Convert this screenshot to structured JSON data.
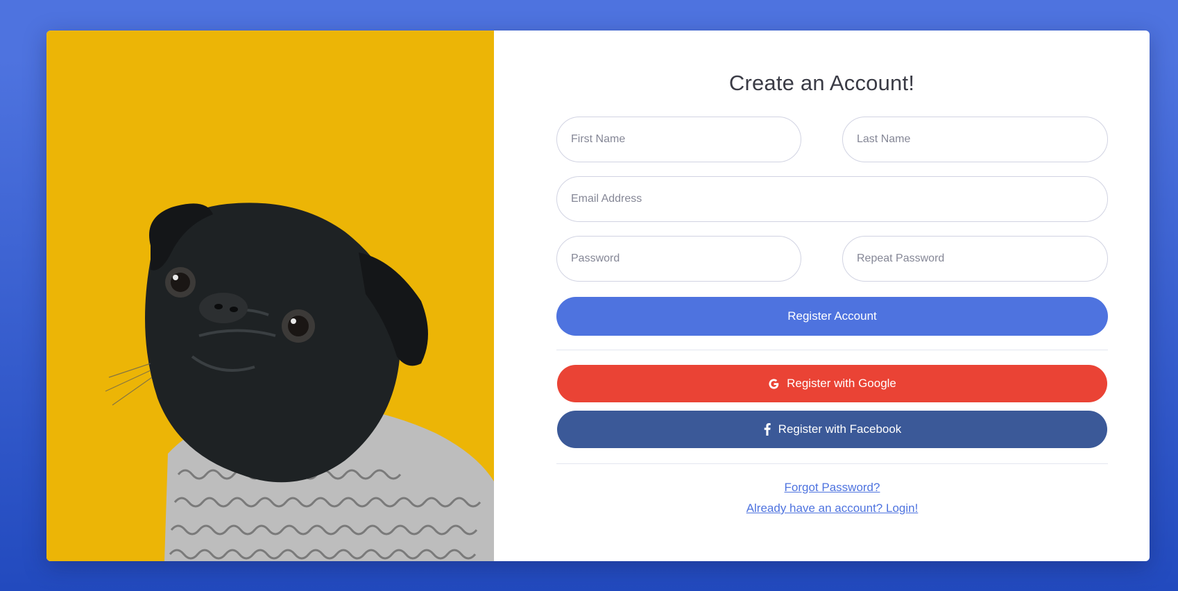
{
  "form": {
    "title": "Create an Account!",
    "first_name": {
      "placeholder": "First Name",
      "value": ""
    },
    "last_name": {
      "placeholder": "Last Name",
      "value": ""
    },
    "email": {
      "placeholder": "Email Address",
      "value": ""
    },
    "password": {
      "placeholder": "Password",
      "value": ""
    },
    "repeat_password": {
      "placeholder": "Repeat Password",
      "value": ""
    },
    "register_label": "Register Account",
    "google_label": "Register with Google",
    "facebook_label": "Register with Facebook",
    "forgot_password_label": "Forgot Password?",
    "login_label": "Already have an account? Login!"
  },
  "image": {
    "icon": "pug-photo"
  },
  "colors": {
    "primary": "#4e73df",
    "google": "#ea4335",
    "facebook": "#3b5998",
    "image_background": "#ecb506"
  }
}
